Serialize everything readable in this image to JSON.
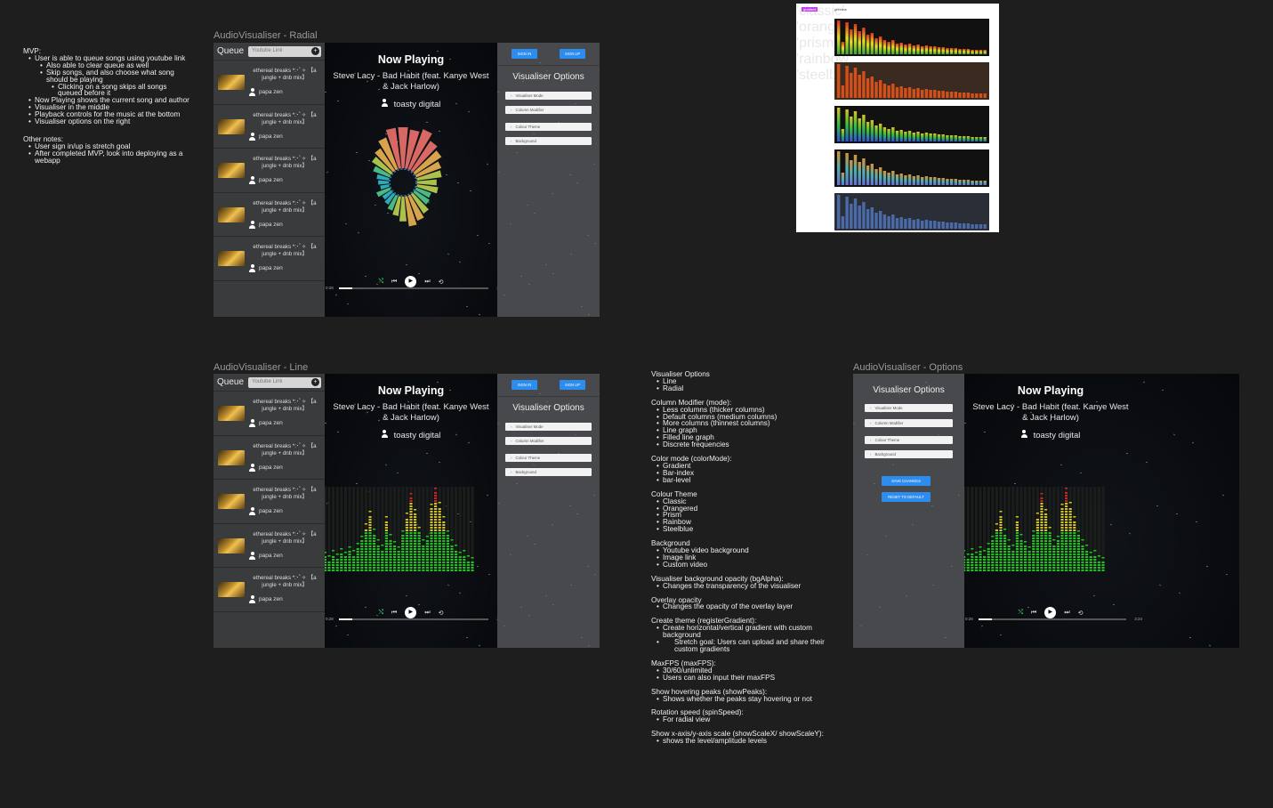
{
  "notes_mvp": {
    "heading": "MVP:",
    "items": [
      "User is able to queue songs using youtube link",
      "Also able to clear queue as well",
      "Skip songs, and also choose what song should be playing",
      "Clicking on a song skips all songs queued before it",
      "Now Playing shows the current song and author",
      "Visualiser in the middle",
      "Playback controls for the music at the bottom",
      "Visualiser options on the right"
    ]
  },
  "notes_other": {
    "heading": "Other notes:",
    "items": [
      "User sign in/up is stretch goal",
      "After completed MVP, look into deploying as a webapp"
    ]
  },
  "frames": {
    "radial": {
      "title": "AudioVisualiser - Radial"
    },
    "line": {
      "title": "AudioVisualiser - Line"
    },
    "options": {
      "title": "AudioVisualiser - Options"
    }
  },
  "player": {
    "queue_label": "Queue",
    "youtube_placeholder": "Youtube Link",
    "add_icon": "+",
    "now_playing": "Now Playing",
    "song": "Steve Lacy - Bad Habit (feat. Kanye West & Jack Harlow)",
    "artist": "toasty digital",
    "time_current": "0:28",
    "time_total": "3:24",
    "progress": 0.09,
    "sign_in": "SIGN IN",
    "sign_up": "SIGN UP",
    "visualiser_options": "Visualiser Options",
    "options": [
      "Visualiser Mode",
      "Column Modifier",
      "Colour Theme",
      "Background"
    ],
    "save_changes": "SAVE CHANGES",
    "reset_default": "RESET TO DEFAULT"
  },
  "queue_items": [
    {
      "title": "ethereal breaks *:･ﾟ✧ 【a jungle + dnb mix】",
      "author": "papa zen"
    },
    {
      "title": "ethereal breaks *:･ﾟ✧ 【a jungle + dnb mix】",
      "author": "papa zen"
    },
    {
      "title": "ethereal breaks *:･ﾟ✧ 【a jungle + dnb mix】",
      "author": "papa zen"
    },
    {
      "title": "ethereal breaks *:･ﾟ✧ 【a jungle + dnb mix】",
      "author": "papa zen"
    },
    {
      "title": "ethereal breaks *:･ﾟ✧ 【a jungle + dnb mix】",
      "author": "papa zen"
    }
  ],
  "spec": [
    {
      "heading": "Visualiser Options",
      "items": [
        "Line",
        "Radial"
      ]
    },
    {
      "heading": "Column Modifier (mode):",
      "items": [
        "Less columns (thicker columns)",
        "Default columns (medium columns)",
        "More columns (thinnest columns)",
        "Line graph",
        "Filled line graph",
        "Discrete frequencies"
      ]
    },
    {
      "heading": "Color mode (colorMode):",
      "items": [
        "Gradient",
        "Bar-index",
        "bar-level"
      ]
    },
    {
      "heading": "Colour Theme",
      "items": [
        "Classic",
        "Orangered",
        "Prism",
        "Rainbow",
        "Steelblue"
      ]
    },
    {
      "heading": "Background",
      "items": [
        "Youtube video background",
        "Image link",
        "Custom video"
      ]
    },
    {
      "heading": "Visualiser background opacity (bgAlpha):",
      "items": [
        "Changes the transparency of the visualiser"
      ]
    },
    {
      "heading": "Overlay opacity",
      "items": [
        "Changes the opacity of the overlay layer"
      ]
    },
    {
      "heading": "Create theme (registerGradient):",
      "items": [
        "Create horizontal/vertical gradient with custom background",
        "Stretch goal: Users can upload and share their custom gradients"
      ]
    },
    {
      "heading": "MaxFPS (maxFPS):",
      "items": [
        "30/60/unlimited",
        "Users can also input their maxFPS"
      ]
    },
    {
      "heading": "Show hovering peaks (showPeaks):",
      "items": [
        "Shows whether the peaks stay hovering or not"
      ]
    },
    {
      "heading": "Rotation speed (spinSpeed):",
      "items": [
        "For radial view"
      ]
    },
    {
      "heading": "Show x-axis/y-axis scale (showScaleX/ showScaleY):",
      "items": [
        "shows the level/amplitude levels"
      ]
    }
  ],
  "theme_table": {
    "header_name": "gradient",
    "header_preview": "preview",
    "rows": [
      {
        "name": "'classic'",
        "colors": [
          "#3aa83a",
          "#e0e020",
          "#e03020"
        ]
      },
      {
        "name": "'orangered'",
        "colors": [
          "#d4501a",
          "#d4501a",
          "#d4501a"
        ]
      },
      {
        "name": "'prism'",
        "colors": [
          "#3050e0",
          "#30c040",
          "#e0c020"
        ]
      },
      {
        "name": "'rainbow'",
        "colors": [
          "#6a70d0",
          "#50b0b0",
          "#e09030"
        ]
      },
      {
        "name": "'steelblue'",
        "colors": [
          "#4a6aa8",
          "#4a6aa8",
          "#4a6aa8"
        ]
      }
    ]
  },
  "colors": {
    "accent": "#2d8cf0",
    "shuffle": "#3cd070"
  },
  "icons": [
    "user-icon",
    "shuffle-icon",
    "previous-icon",
    "play-icon",
    "next-icon",
    "repeat-icon",
    "plus-icon"
  ]
}
